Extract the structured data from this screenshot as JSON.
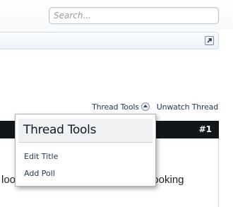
{
  "search": {
    "placeholder": "Search..."
  },
  "thread_controls": {
    "thread_tools_label": "Thread Tools",
    "unwatch_label": "Unwatch Thread"
  },
  "post": {
    "number": "#1",
    "text_fragment": "looking for a clean and finished looking"
  },
  "thread_tools_menu": {
    "title": "Thread Tools",
    "items": [
      {
        "label": "Edit Title"
      },
      {
        "label": "Add Poll"
      }
    ]
  },
  "colors": {
    "post_header_bg": "#121619",
    "link_text": "#26385a",
    "menu_header_bg": "#eff1f3"
  }
}
